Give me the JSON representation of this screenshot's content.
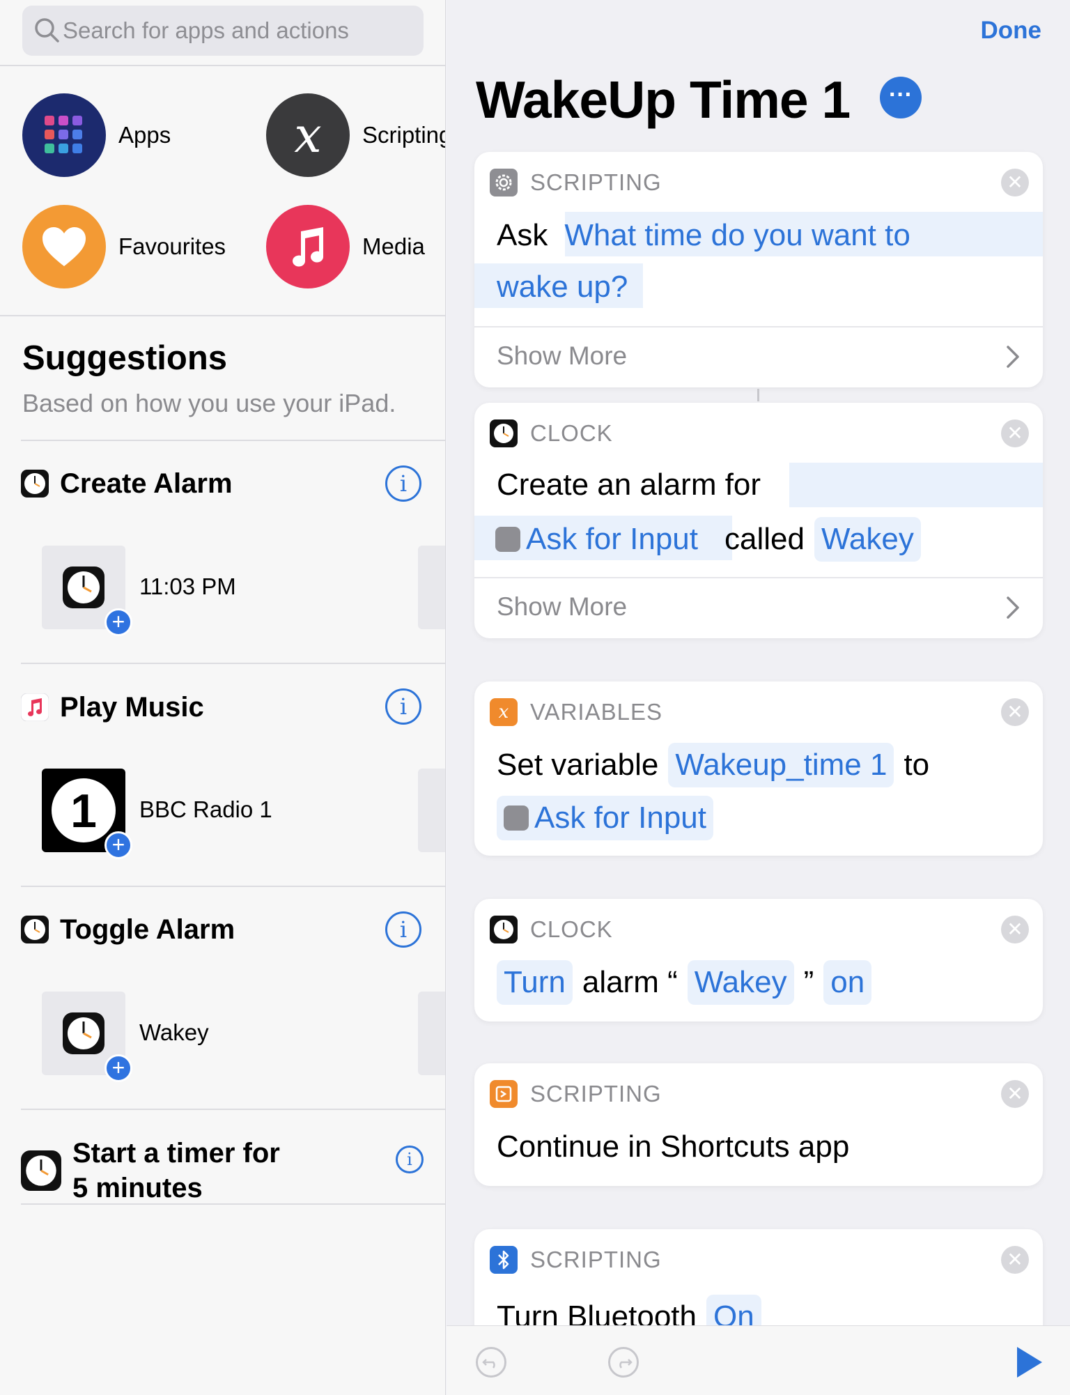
{
  "search": {
    "placeholder": "Search for apps and actions"
  },
  "categories": [
    {
      "label": "Apps",
      "icon": "apps-grid-icon",
      "color": "#1c2a6e"
    },
    {
      "label": "Scripting",
      "icon": "scripting-x-icon",
      "color": "#3a3a3c"
    },
    {
      "label": "Favourites",
      "icon": "heart-icon",
      "color": "#f39a34"
    },
    {
      "label": "Media",
      "icon": "music-note-icon",
      "color": "#e8365a"
    }
  ],
  "suggestions": {
    "title": "Suggestions",
    "subtitle": "Based on how you use your iPad.",
    "sections": [
      {
        "title": "Create Alarm",
        "app_icon": "clock-icon",
        "item_label": "11:03 PM"
      },
      {
        "title": "Play Music",
        "app_icon": "music-icon",
        "item_label": "BBC Radio 1"
      },
      {
        "title": "Toggle Alarm",
        "app_icon": "clock-icon",
        "item_label": "Wakey"
      },
      {
        "title_line1": "Start a timer for",
        "title_line2": "5 minutes",
        "app_icon": "clock-icon"
      }
    ]
  },
  "editor": {
    "done_label": "Done",
    "title": "WakeUp Time 1",
    "cards": [
      {
        "category": "SCRIPTING",
        "verb": "Ask",
        "prompt_line1": "What time do you want to",
        "prompt_line2": "wake up?",
        "show_more": "Show More"
      },
      {
        "category": "CLOCK",
        "line1": "Create an alarm for",
        "token_input": "Ask for Input",
        "called": "called",
        "token_name": "Wakey",
        "show_more": "Show More"
      },
      {
        "category": "VARIABLES",
        "prefix": "Set variable",
        "token_var": "Wakeup_time 1",
        "to": "to",
        "token_input": "Ask for Input"
      },
      {
        "category": "CLOCK",
        "token_turn": "Turn",
        "alarm_open": "alarm “",
        "token_name": "Wakey",
        "close_quote": "”",
        "token_state": "on"
      },
      {
        "category": "SCRIPTING",
        "text": "Continue in Shortcuts app"
      },
      {
        "category": "SCRIPTING",
        "text": "Turn Bluetooth",
        "token_state": "On"
      }
    ]
  },
  "colors": {
    "accent": "#2c73d8",
    "token_bg": "#e9f1fc"
  }
}
